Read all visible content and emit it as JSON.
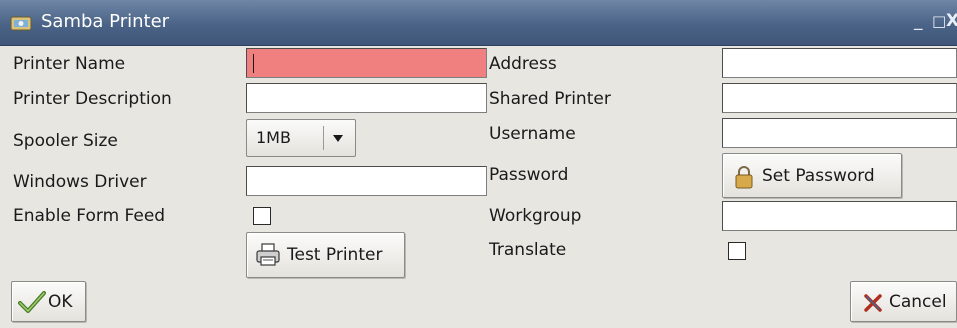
{
  "window": {
    "title": "Samba Printer",
    "minimize_glyph": "_",
    "maximize_glyph": "□",
    "close_glyph": "X"
  },
  "left": {
    "printer_name": {
      "label": "Printer Name",
      "value": ""
    },
    "printer_description": {
      "label": "Printer Description",
      "value": ""
    },
    "spooler_size": {
      "label": "Spooler Size",
      "value": "1MB"
    },
    "windows_driver": {
      "label": "Windows Driver",
      "value": ""
    },
    "enable_form_feed": {
      "label": "Enable Form Feed",
      "checked": false
    },
    "test_printer_label": "Test Printer"
  },
  "right": {
    "address": {
      "label": "Address",
      "value": ""
    },
    "shared_printer": {
      "label": "Shared Printer",
      "value": ""
    },
    "username": {
      "label": "Username",
      "value": ""
    },
    "password": {
      "label": "Password",
      "button_label": "Set Password"
    },
    "workgroup": {
      "label": "Workgroup",
      "value": ""
    },
    "translate": {
      "label": "Translate",
      "checked": false
    }
  },
  "footer": {
    "ok_label": "OK",
    "cancel_label": "Cancel"
  },
  "colors": {
    "title_bar": "#4a6386",
    "error_field": "#f08080",
    "background": "#e8e6e1"
  },
  "icons": [
    "samba-app-icon",
    "printer-icon",
    "lock-icon",
    "ok-check-icon",
    "cancel-x-icon"
  ]
}
